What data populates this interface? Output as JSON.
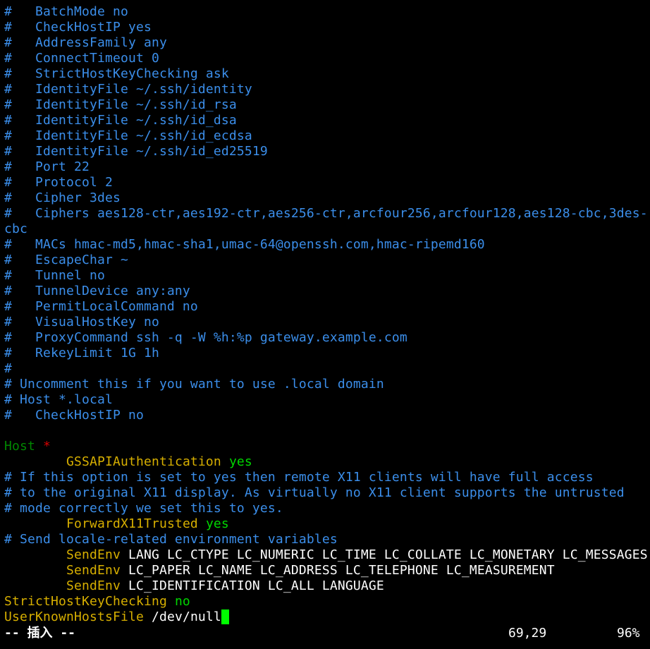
{
  "editor": {
    "comment_lines": [
      "#   BatchMode no",
      "#   CheckHostIP yes",
      "#   AddressFamily any",
      "#   ConnectTimeout 0",
      "#   StrictHostKeyChecking ask",
      "#   IdentityFile ~/.ssh/identity",
      "#   IdentityFile ~/.ssh/id_rsa",
      "#   IdentityFile ~/.ssh/id_dsa",
      "#   IdentityFile ~/.ssh/id_ecdsa",
      "#   IdentityFile ~/.ssh/id_ed25519",
      "#   Port 22",
      "#   Protocol 2",
      "#   Cipher 3des",
      "#   Ciphers aes128-ctr,aes192-ctr,aes256-ctr,arcfour256,arcfour128,aes128-cbc,3des-",
      "cbc",
      "#   MACs hmac-md5,hmac-sha1,umac-64@openssh.com,hmac-ripemd160",
      "#   EscapeChar ~",
      "#   Tunnel no",
      "#   TunnelDevice any:any",
      "#   PermitLocalCommand no",
      "#   VisualHostKey no",
      "#   ProxyCommand ssh -q -W %h:%p gateway.example.com",
      "#   RekeyLimit 1G 1h",
      "#",
      "# Uncomment this if you want to use .local domain",
      "# Host *.local",
      "#   CheckHostIP no"
    ],
    "host": {
      "keyword": "Host",
      "pattern": "*"
    },
    "gssapi": {
      "key": "GSSAPIAuthentication",
      "value": "yes"
    },
    "x11_comments": [
      "# If this option is set to yes then remote X11 clients will have full access",
      "# to the original X11 display. As virtually no X11 client supports the untrusted",
      "# mode correctly we set this to yes."
    ],
    "forward_x11": {
      "key": "ForwardX11Trusted",
      "value": "yes"
    },
    "locale_comment": "# Send locale-related environment variables",
    "sendenv": [
      {
        "key": "SendEnv",
        "vars": "LANG LC_CTYPE LC_NUMERIC LC_TIME LC_COLLATE LC_MONETARY LC_MESSAGES"
      },
      {
        "key": "SendEnv",
        "vars": "LC_PAPER LC_NAME LC_ADDRESS LC_TELEPHONE LC_MEASUREMENT"
      },
      {
        "key": "SendEnv",
        "vars": "LC_IDENTIFICATION LC_ALL LANGUAGE"
      }
    ],
    "strict_host": {
      "key": "StrictHostKeyChecking",
      "value": "no"
    },
    "known_hosts": {
      "key": "UserKnownHostsFile",
      "value": "/dev/null"
    }
  },
  "statusbar": {
    "mode": "-- 插入 --",
    "position": "69,29",
    "percent": "96%"
  },
  "colors": {
    "background": "#000000",
    "comment": "#3b8eea",
    "keyword": "#d7af00",
    "value": "#00d700",
    "host_keyword": "#008700",
    "host_pattern": "#d70000",
    "cursor": "#00ff00"
  }
}
